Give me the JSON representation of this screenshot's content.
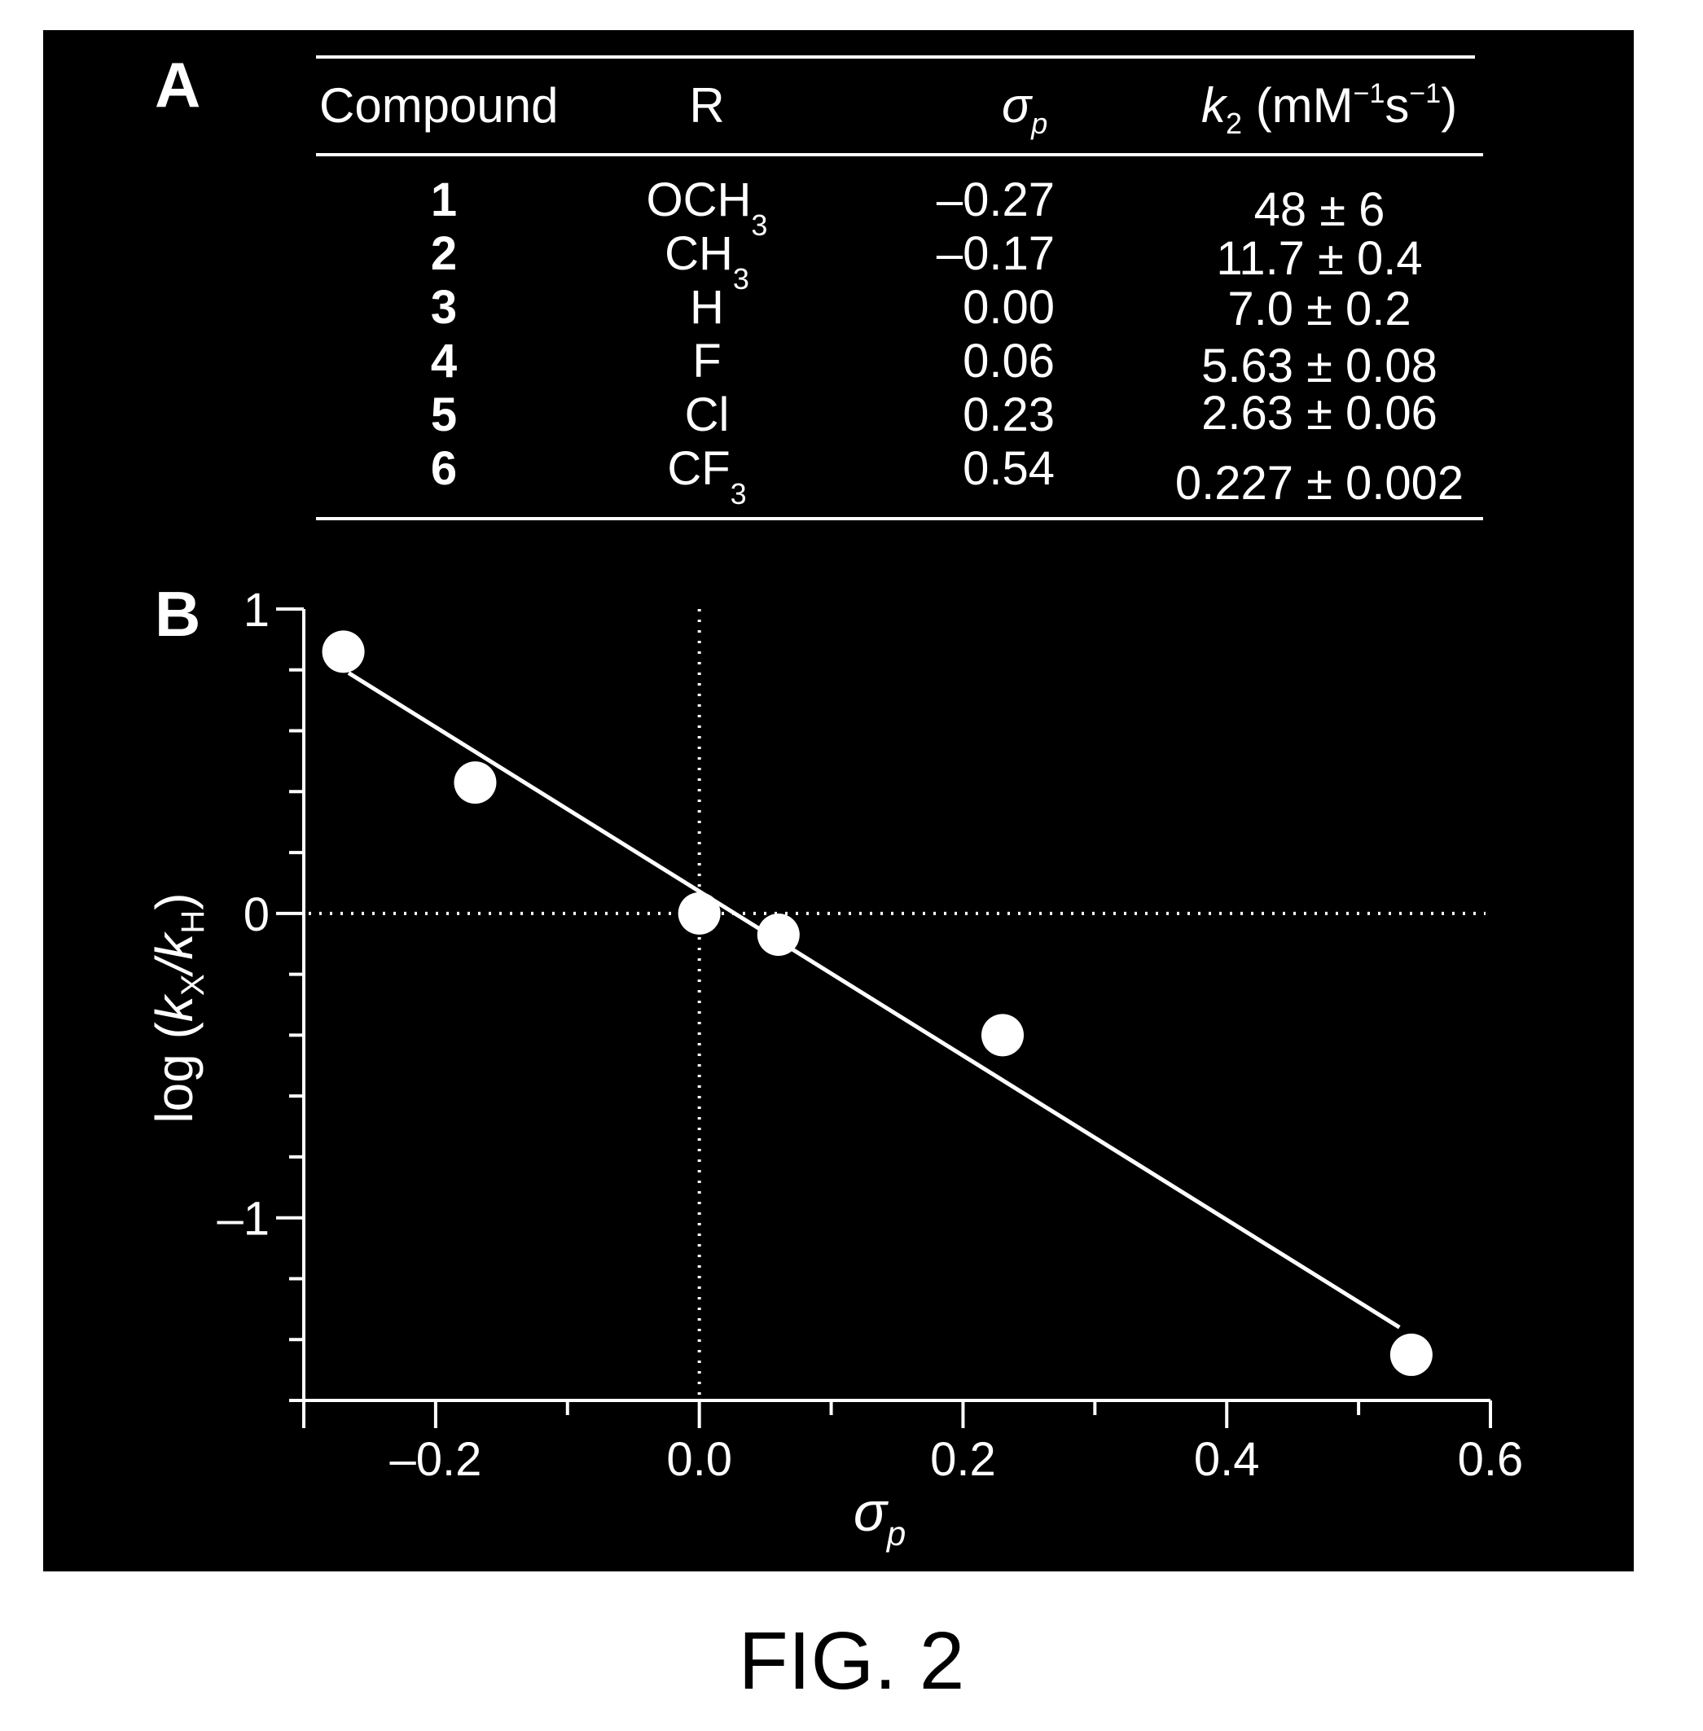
{
  "figure_caption": "FIG. 2",
  "panel_a": {
    "label": "A",
    "headers": {
      "compound": "Compound",
      "r": "R",
      "sigma_main": "σ",
      "sigma_sub": "p",
      "k2_main": "k",
      "k2_sub": "2",
      "k2_units_open": " (mM",
      "k2_units_exp1": "−1",
      "k2_units_s": "s",
      "k2_units_exp2": "−1",
      "k2_units_close": ")"
    },
    "rows": [
      {
        "compound": "1",
        "r_main": "OCH",
        "r_sub": "3",
        "sigma_p": "–0.27",
        "k2": "48 ± 6"
      },
      {
        "compound": "2",
        "r_main": "CH",
        "r_sub": "3",
        "sigma_p": "–0.17",
        "k2": "11.7 ± 0.4"
      },
      {
        "compound": "3",
        "r_main": "H",
        "r_sub": "",
        "sigma_p": "0.00",
        "k2": "7.0 ± 0.2"
      },
      {
        "compound": "4",
        "r_main": "F",
        "r_sub": "",
        "sigma_p": "0.06",
        "k2": "5.63 ± 0.08"
      },
      {
        "compound": "5",
        "r_main": "Cl",
        "r_sub": "",
        "sigma_p": "0.23",
        "k2": "2.63 ± 0.06"
      },
      {
        "compound": "6",
        "r_main": "CF",
        "r_sub": "3",
        "sigma_p": "0.54",
        "k2": "0.227 ± 0.002"
      }
    ]
  },
  "chart_data": {
    "type": "scatter",
    "panel_label": "B",
    "title": "",
    "xlabel": {
      "main": "σ",
      "sub": "p"
    },
    "ylabel": {
      "prefix": "log (",
      "k1": "k",
      "sub1": "X",
      "slash": "/",
      "k2": "k",
      "sub2": "H",
      "suffix": ")"
    },
    "xlim": [
      -0.3,
      0.6
    ],
    "ylim": [
      -1.6,
      1.0
    ],
    "x_ticks_major": [
      -0.2,
      0.0,
      0.2,
      0.4,
      0.6
    ],
    "x_tick_labels": [
      "–0.2",
      "0.0",
      "0.2",
      "0.4",
      "0.6"
    ],
    "x_ticks_minor": [
      -0.3,
      -0.1,
      0.1,
      0.3,
      0.5
    ],
    "y_ticks_major": [
      1,
      0,
      -1
    ],
    "y_tick_labels": [
      "1",
      "0",
      "–1"
    ],
    "y_ticks_minor": [
      0.8,
      0.6,
      0.4,
      0.2,
      -0.2,
      -0.4,
      -0.6,
      -0.8,
      -1.2,
      -1.4,
      -1.6
    ],
    "reference_lines": {
      "x": 0,
      "y": 0,
      "style": "dotted"
    },
    "grid": false,
    "legend": "none",
    "series": [
      {
        "name": "substituents",
        "marker": "filled-circle",
        "color": "#ffffff",
        "points": [
          {
            "label": "OCH3",
            "x": -0.27,
            "y": 0.86
          },
          {
            "label": "CH3",
            "x": -0.17,
            "y": 0.43
          },
          {
            "label": "H",
            "x": 0.0,
            "y": 0.0
          },
          {
            "label": "F",
            "x": 0.06,
            "y": -0.07
          },
          {
            "label": "Cl",
            "x": 0.23,
            "y": -0.4
          },
          {
            "label": "CF3",
            "x": 0.54,
            "y": -1.45
          }
        ]
      },
      {
        "name": "linear-fit",
        "type": "line",
        "color": "#ffffff",
        "x": [
          -0.266,
          0.531
        ],
        "y": [
          0.79,
          -1.36
        ]
      }
    ]
  },
  "colors": {
    "panel_background": "#000000",
    "foreground": "#ffffff",
    "page_background": "#ffffff",
    "caption_text": "#000000"
  }
}
